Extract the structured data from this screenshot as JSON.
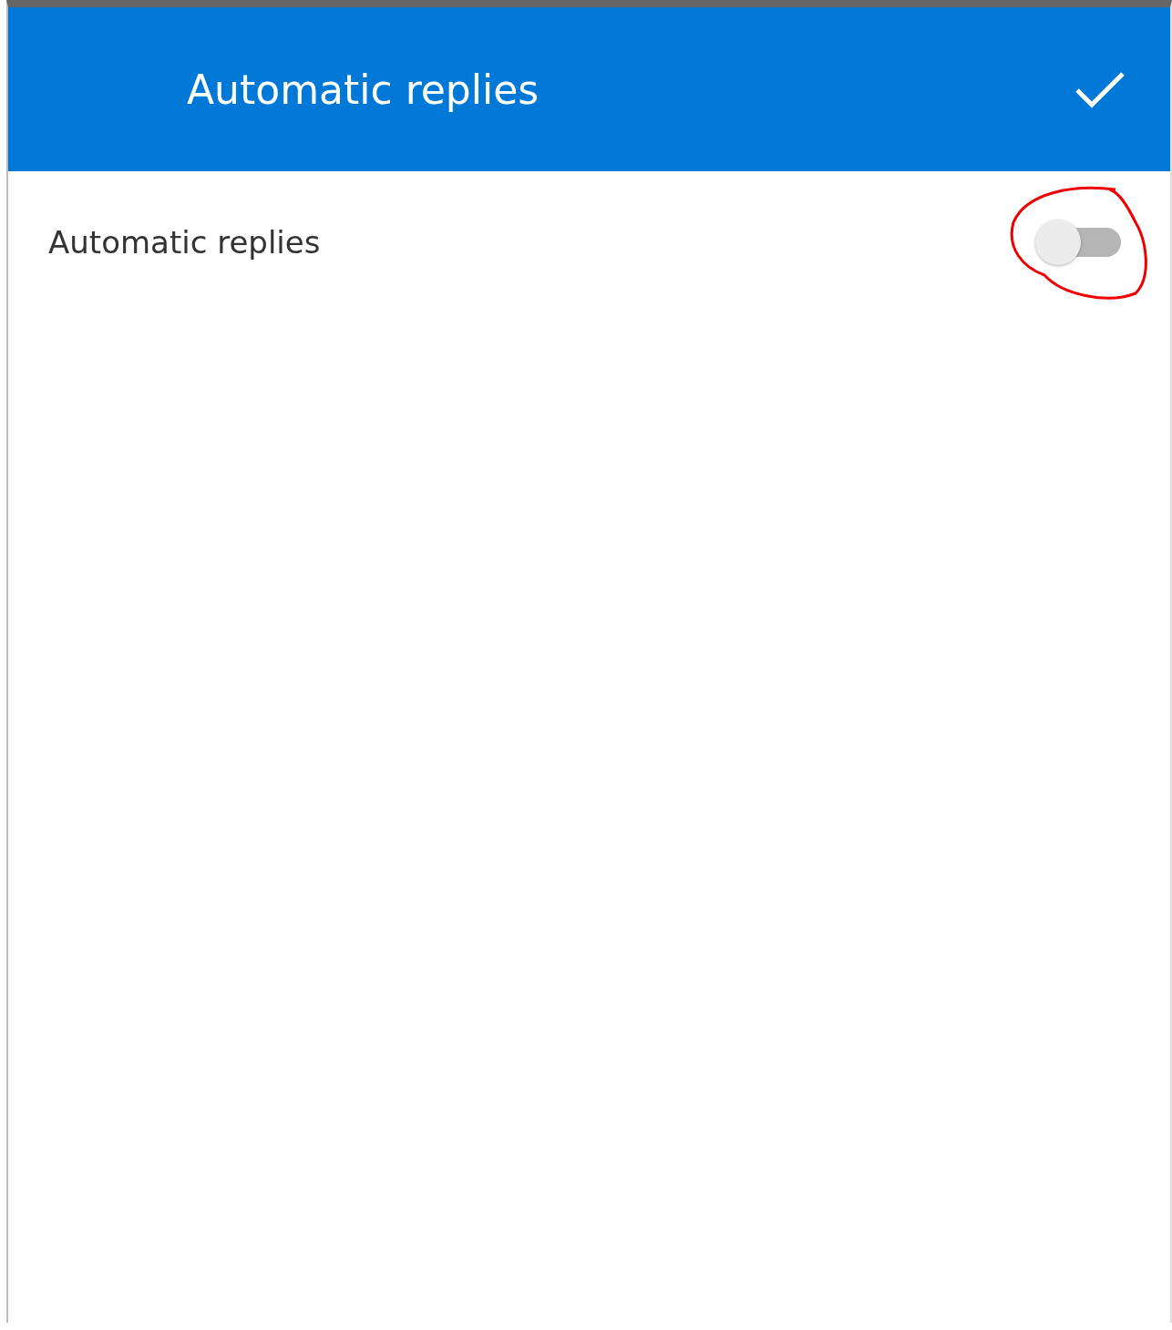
{
  "header": {
    "title": "Automatic replies"
  },
  "settings": [
    {
      "kind": "toggle",
      "label": "Automatic replies",
      "on": false
    }
  ]
}
